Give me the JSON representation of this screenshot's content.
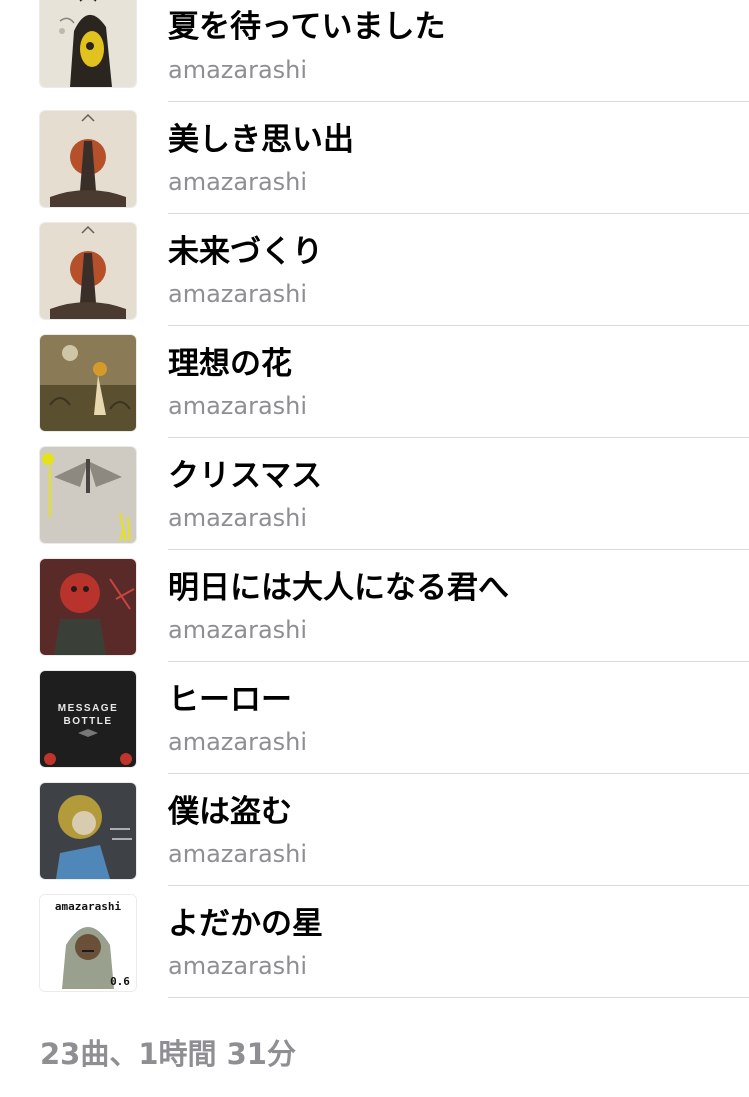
{
  "tracks": [
    {
      "title": "夏を待っていました",
      "artist": "amazarashi",
      "artwork": "artwork-summer-girl"
    },
    {
      "title": "美しき思い出",
      "artist": "amazarashi",
      "artwork": "artwork-red-sun-figure"
    },
    {
      "title": "未来づくり",
      "artist": "amazarashi",
      "artwork": "artwork-red-sun-figure"
    },
    {
      "title": "理想の花",
      "artist": "amazarashi",
      "artwork": "artwork-flower-field"
    },
    {
      "title": "クリスマス",
      "artist": "amazarashi",
      "artwork": "artwork-angel-wings"
    },
    {
      "title": "明日には大人になる君へ",
      "artist": "amazarashi",
      "artwork": "artwork-red-mask"
    },
    {
      "title": "ヒーロー",
      "artist": "amazarashi",
      "artwork": "artwork-message-bottle",
      "artwork_text": [
        "MESSAGE",
        "BOTTLE"
      ]
    },
    {
      "title": "僕は盗む",
      "artist": "amazarashi",
      "artwork": "artwork-gold-portrait"
    },
    {
      "title": "よだかの星",
      "artist": "amazarashi",
      "artwork": "artwork-hooded-child",
      "artwork_text": [
        "amazarashi",
        "0.6"
      ]
    }
  ],
  "summary": "23曲、1時間 31分"
}
